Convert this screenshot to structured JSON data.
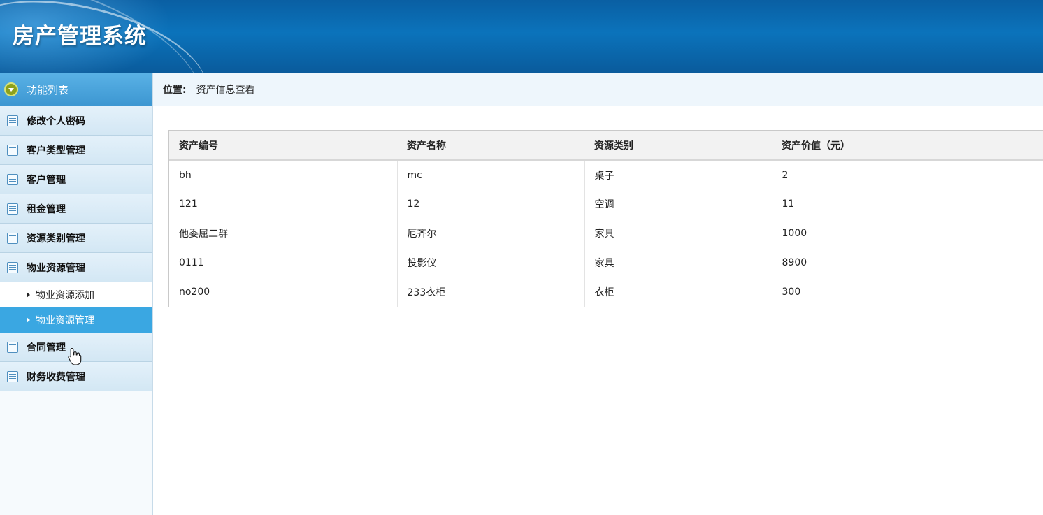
{
  "header": {
    "title": "房产管理系统"
  },
  "sidebar": {
    "head_label": "功能列表",
    "items": [
      {
        "label": "修改个人密码"
      },
      {
        "label": "客户类型管理"
      },
      {
        "label": "客户管理"
      },
      {
        "label": "租金管理"
      },
      {
        "label": "资源类别管理"
      },
      {
        "label": "物业资源管理"
      }
    ],
    "subitems": [
      {
        "label": "物业资源添加",
        "active": false
      },
      {
        "label": "物业资源管理",
        "active": true
      }
    ],
    "items_after": [
      {
        "label": "合同管理"
      },
      {
        "label": "财务收费管理"
      }
    ]
  },
  "breadcrumb": {
    "label": "位置:",
    "value": "资产信息查看"
  },
  "table": {
    "headers": [
      "资产编号",
      "资产名称",
      "资源类别",
      "资产价值（元）"
    ],
    "rows": [
      [
        "bh",
        "mc",
        "桌子",
        "2"
      ],
      [
        "121",
        "12",
        "空调",
        "11"
      ],
      [
        "他委屈二群",
        "厄齐尔",
        "家具",
        "1000"
      ],
      [
        "0111",
        "投影仪",
        "家具",
        "8900"
      ],
      [
        "no200",
        "233衣柜",
        "衣柜",
        "300"
      ]
    ]
  },
  "colors": {
    "header_blue": "#0b73bb",
    "active_blue": "#3aa7e2",
    "sidebar_head": "#3c96d1"
  }
}
